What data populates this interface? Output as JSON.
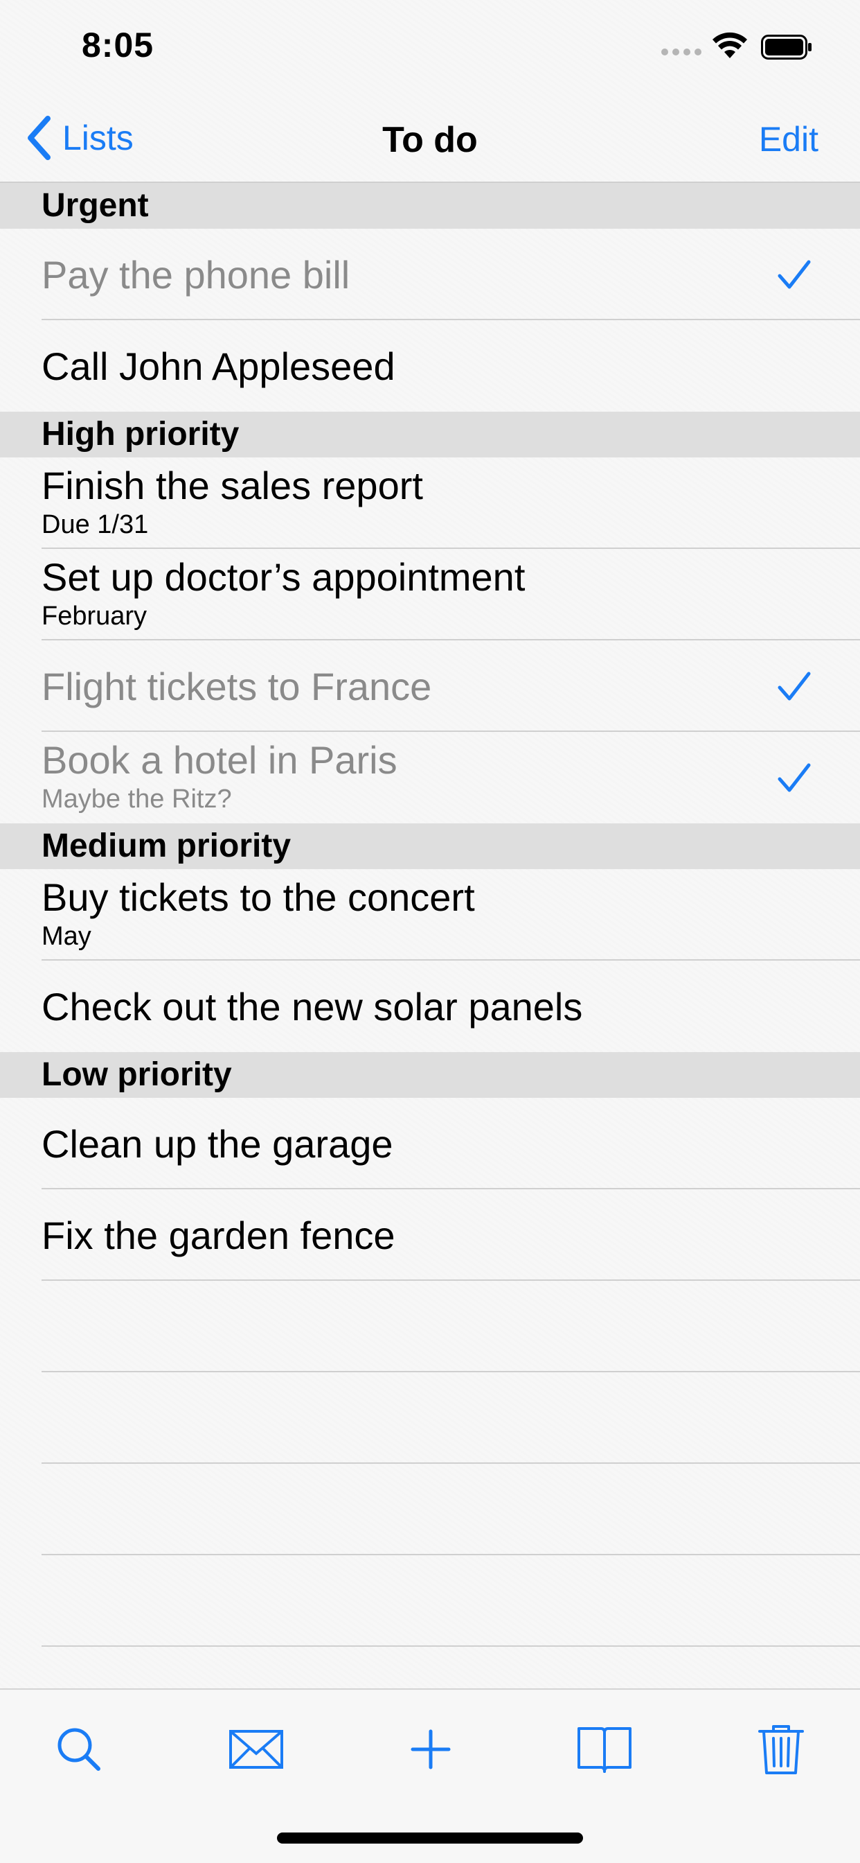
{
  "status_bar": {
    "time": "8:05"
  },
  "nav": {
    "back_label": "Lists",
    "title": "To do",
    "edit_label": "Edit"
  },
  "colors": {
    "accent": "#1a7cf5",
    "done_text": "#8a8a8a",
    "section_bg": "#dedede"
  },
  "sections": [
    {
      "header": "Urgent",
      "items": [
        {
          "title": "Pay the phone bill",
          "subtitle": "",
          "done": true
        },
        {
          "title": "Call John Appleseed",
          "subtitle": "",
          "done": false
        }
      ]
    },
    {
      "header": "High priority",
      "items": [
        {
          "title": "Finish the sales report",
          "subtitle": "Due 1/31",
          "done": false
        },
        {
          "title": "Set up doctor’s appointment",
          "subtitle": "February",
          "done": false
        },
        {
          "title": "Flight tickets to France",
          "subtitle": "",
          "done": true
        },
        {
          "title": "Book a hotel in Paris",
          "subtitle": "Maybe the Ritz?",
          "done": true
        }
      ]
    },
    {
      "header": "Medium priority",
      "items": [
        {
          "title": "Buy tickets to the concert",
          "subtitle": "May",
          "done": false
        },
        {
          "title": "Check out the new solar panels",
          "subtitle": "",
          "done": false
        }
      ]
    },
    {
      "header": "Low priority",
      "items": [
        {
          "title": "Clean up the garage",
          "subtitle": "",
          "done": false
        },
        {
          "title": "Fix the garden fence",
          "subtitle": "",
          "done": false
        }
      ]
    }
  ],
  "toolbar": {
    "icons": [
      "search-icon",
      "mail-icon",
      "add-icon",
      "book-icon",
      "trash-icon"
    ]
  }
}
